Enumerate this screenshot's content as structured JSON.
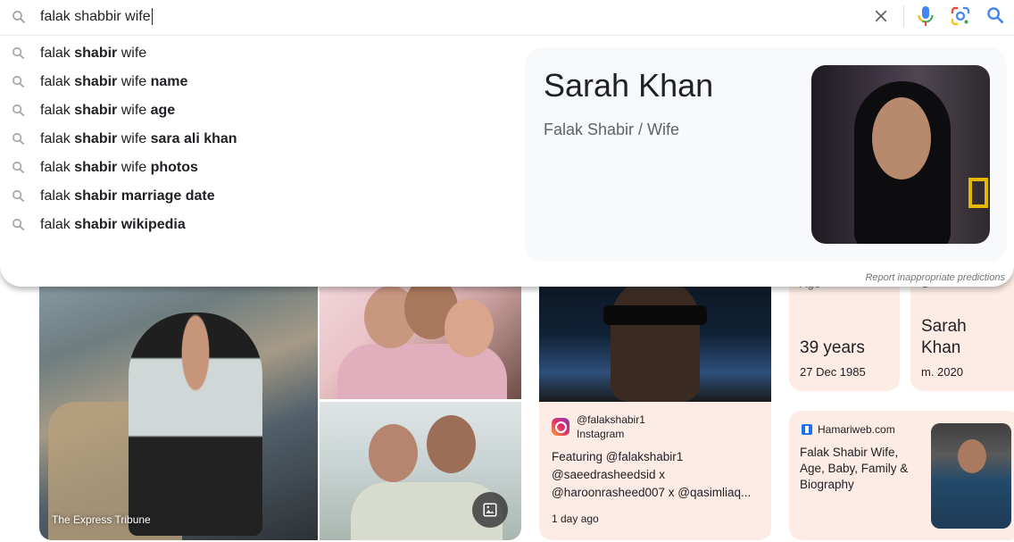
{
  "search": {
    "query": "falak shabbir wife"
  },
  "suggestions": [
    {
      "plain": "falak ",
      "bold": "shabir",
      "rest": " wife",
      "bold2": ""
    },
    {
      "plain": "falak ",
      "bold": "shabir",
      "rest": " wife ",
      "bold2": "name"
    },
    {
      "plain": "falak ",
      "bold": "shabir",
      "rest": " wife ",
      "bold2": "age"
    },
    {
      "plain": "falak ",
      "bold": "shabir",
      "rest": " wife ",
      "bold2": "sara ali khan"
    },
    {
      "plain": "falak ",
      "bold": "shabir",
      "rest": " wife ",
      "bold2": "photos"
    },
    {
      "plain": "falak ",
      "bold": "shabir marriage date",
      "rest": "",
      "bold2": ""
    },
    {
      "plain": "falak ",
      "bold": "shabir wikipedia",
      "rest": "",
      "bold2": ""
    }
  ],
  "knowledge_panel": {
    "name": "Sarah Khan",
    "subtitle": "Falak Shabir / Wife"
  },
  "report_link": "Report inappropriate predictions",
  "results": {
    "express_source": "The Express Tribune",
    "instagram": {
      "handle": "@falakshabir1",
      "platform": "Instagram",
      "text": "Featuring @falakshabir1 @saeedrasheedsid x @haroonrasheed007 x @qasimliaq...",
      "time": "1 day ago"
    },
    "age_card": {
      "label_cut": "Age",
      "value": "39 years",
      "detail": "27 Dec 1985"
    },
    "spouse_card": {
      "label_cut": "S",
      "value_line1": "Sarah",
      "value_line2": "Khan",
      "detail": "m. 2020"
    },
    "hamariweb": {
      "source": "Hamariweb.com",
      "title": "Falak Shabir Wife, Age, Baby, Family & Biography"
    }
  },
  "colors": {
    "card_bg": "#fdece6",
    "panel_bg": "#f8f9fa",
    "google_blue": "#4285f4",
    "google_red": "#ea4335",
    "google_yellow": "#fbbc05",
    "google_green": "#34a853"
  },
  "icons": {
    "search": "search-icon",
    "clear": "close-icon",
    "mic": "microphone-icon",
    "lens": "camera-lens-icon",
    "image_search": "image-icon"
  }
}
